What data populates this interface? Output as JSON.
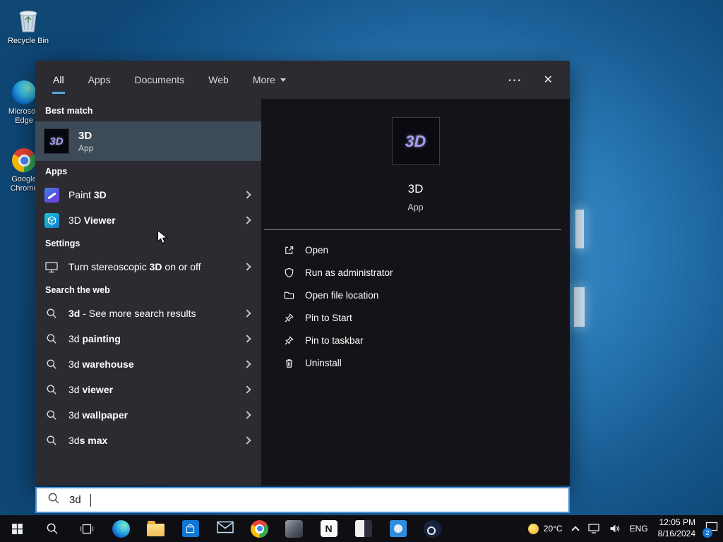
{
  "desktop": {
    "recycle_bin": "Recycle Bin",
    "edge": "Microsoft Edge",
    "chrome": "Google Chrome"
  },
  "glyphs": {
    "ellipsis": "⋯",
    "close": "✕"
  },
  "tabs": {
    "all": "All",
    "apps": "Apps",
    "documents": "Documents",
    "web": "Web",
    "more": "More"
  },
  "left": {
    "best_match_header": "Best match",
    "best_match": {
      "logo": "3D",
      "title": "3D",
      "subtitle": "App"
    },
    "apps_header": "Apps",
    "apps": [
      {
        "prefix": "Paint ",
        "bold": "3D",
        "suffix": ""
      },
      {
        "prefix": "3D ",
        "bold": "Viewer",
        "suffix": ""
      }
    ],
    "settings_header": "Settings",
    "settings": [
      {
        "prefix": "Turn stereoscopic ",
        "bold": "3D",
        "suffix": " on or off"
      }
    ],
    "web_header": "Search the web",
    "web": [
      {
        "prefix": "",
        "bold": "3d",
        "suffix": " - See more search results"
      },
      {
        "prefix": "3d ",
        "bold": "painting",
        "suffix": ""
      },
      {
        "prefix": "3d ",
        "bold": "warehouse",
        "suffix": ""
      },
      {
        "prefix": "3d ",
        "bold": "viewer",
        "suffix": ""
      },
      {
        "prefix": "3d ",
        "bold": "wallpaper",
        "suffix": ""
      },
      {
        "prefix": "3d",
        "bold": "s max",
        "suffix": ""
      }
    ]
  },
  "preview": {
    "logo": "3D",
    "app_name": "3D",
    "app_type": "App",
    "actions": [
      "Open",
      "Run as administrator",
      "Open file location",
      "Pin to Start",
      "Pin to taskbar",
      "Uninstall"
    ]
  },
  "search_box": {
    "query": "3d"
  },
  "taskbar": {
    "notion_letter": "N"
  },
  "tray": {
    "temp": "20°C",
    "lang": "ENG",
    "time": "12:05 PM",
    "date": "8/16/2024",
    "badge": "2"
  }
}
